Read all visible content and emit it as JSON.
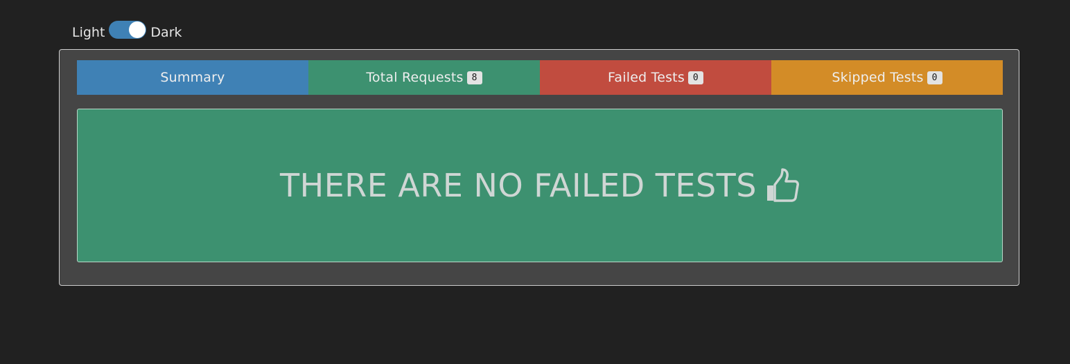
{
  "theme_switch": {
    "left_label": "Light",
    "right_label": "Dark",
    "state": "dark"
  },
  "tabs": [
    {
      "label": "Summary",
      "badge": null,
      "color": "#3f81b5"
    },
    {
      "label": "Total Requests",
      "badge": "8",
      "color": "#3d9170"
    },
    {
      "label": "Failed Tests",
      "badge": "0",
      "color": "#c14c3f"
    },
    {
      "label": "Skipped Tests",
      "badge": "0",
      "color": "#d38c27"
    }
  ],
  "panel": {
    "message": "THERE ARE NO FAILED TESTS",
    "icon": "thumbs-up-icon",
    "color": "#3d9170"
  }
}
